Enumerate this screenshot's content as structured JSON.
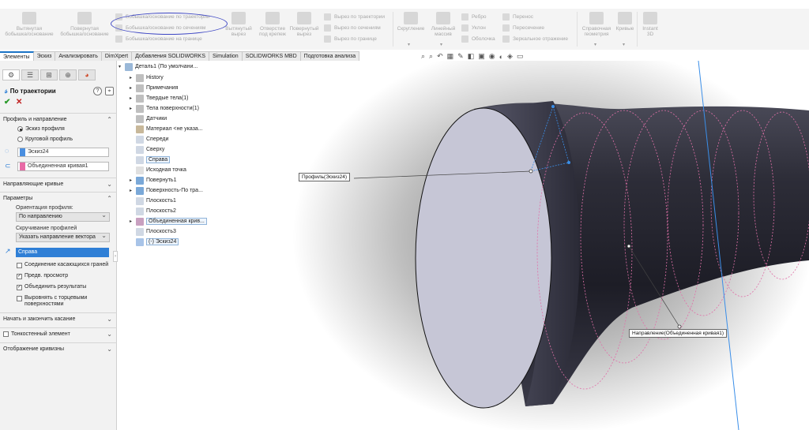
{
  "ribbon": {
    "big_buttons": [
      {
        "label": "Вытянутая бобышка/основание"
      },
      {
        "label": "Повернутая бобышка/основание"
      },
      {
        "label": "Вытянутый вырез"
      },
      {
        "label": "Отверстие под крепеж"
      },
      {
        "label": "Повернутый вырез"
      },
      {
        "label": "Скругление"
      },
      {
        "label": "Линейный массив"
      },
      {
        "label": "Справочная геометрия"
      },
      {
        "label": "Кривые"
      },
      {
        "label": "Instant 3D"
      }
    ],
    "small_buttons_col1": [
      "Бобышка/основание по траектории",
      "Бобышка/основание по сечениям",
      "Бобышка/основание на границе"
    ],
    "small_buttons_col2": [
      "Вырез по траектории",
      "Вырез по сечениям",
      "Вырез по границе"
    ],
    "small_buttons_col3": [
      "Ребро",
      "Уклон",
      "Оболочка"
    ],
    "small_buttons_col4": [
      "Перенос",
      "Пересечение",
      "Зеркальное отражение"
    ]
  },
  "tabs": [
    "Элементы",
    "Эскиз",
    "Анализировать",
    "DimXpert",
    "Добавления SOLIDWORKS",
    "Simulation",
    "SOLIDWORKS MBD",
    "Подготовка анализа"
  ],
  "property_manager": {
    "title": "По траектории",
    "sections": {
      "profile_direction": "Профиль и направление",
      "guide_curves": "Направляющие кривые",
      "parameters": "Параметры",
      "start_end_tangency": "Начать и закончить касание",
      "thin_feature": "Тонкостенный элемент",
      "curvature_display": "Отображение кривизны"
    },
    "radio_sketch_profile": "Эскиз профиля",
    "radio_circular_profile": "Круговой профиль",
    "profile_value": "Эскиз24",
    "path_value": "Объединенная кривая1",
    "orientation_label": "Ориентация профиля:",
    "orientation_value": "По направлению",
    "twist_label": "Скручивание профилей",
    "twist_value": "Указать направление вектора",
    "direction_value": "Справа",
    "chk_merge_tangent": "Соединение касающихся граней",
    "chk_preview": "Предв. просмотр",
    "chk_merge_results": "Объединить результаты",
    "chk_align_end_faces": "Выровнять с торцевыми поверхностями",
    "help_symbol": "?",
    "ok_symbol": "✔",
    "cancel_symbol": "✕"
  },
  "tree": {
    "root": "Деталь1 (По умолчани...",
    "items": [
      {
        "label": "History",
        "arrow": true
      },
      {
        "label": "Примечания",
        "arrow": true
      },
      {
        "label": "Твердые тела(1)",
        "arrow": true
      },
      {
        "label": "Тела поверхности(1)",
        "arrow": true
      },
      {
        "label": "Датчики",
        "arrow": false
      },
      {
        "label": "Материал <не указа...",
        "arrow": false
      },
      {
        "label": "Спереди",
        "arrow": false
      },
      {
        "label": "Сверху",
        "arrow": false
      },
      {
        "label": "Справа",
        "arrow": false
      },
      {
        "label": "Исходная точка",
        "arrow": false
      },
      {
        "label": "Повернуть1",
        "arrow": true
      },
      {
        "label": "Поверхность-По тра...",
        "arrow": true
      },
      {
        "label": "Плоскость1",
        "arrow": false
      },
      {
        "label": "Плоскость2",
        "arrow": false
      },
      {
        "label": "Объединенная крив...",
        "arrow": true
      },
      {
        "label": "Плоскость3",
        "arrow": false
      },
      {
        "label": "(-) Эскиз24",
        "arrow": false
      }
    ]
  },
  "callouts": {
    "profile": "Профиль(Эскиз24)",
    "path": "Направление(Объединенная кривая1)"
  },
  "colors": {
    "accent": "#2f7fd6",
    "profile_swatch": "#4a8fe0",
    "path_swatch": "#e86aa6",
    "annotation_circle": "#3d46c4"
  }
}
